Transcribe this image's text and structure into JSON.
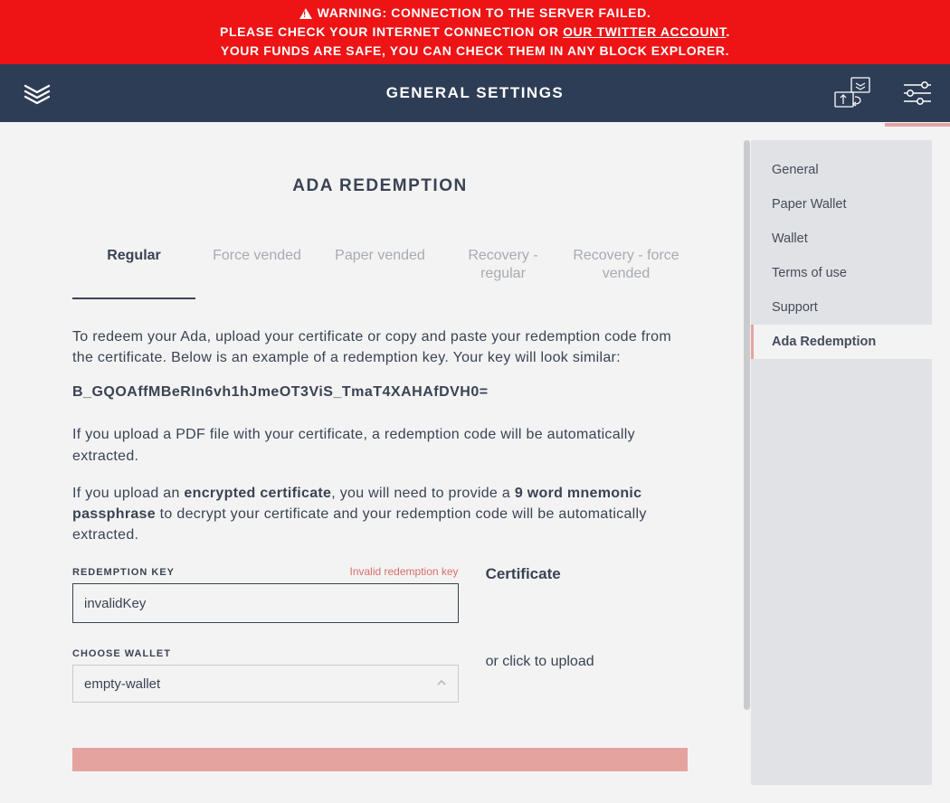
{
  "banner": {
    "line1": "WARNING: CONNECTION TO THE SERVER FAILED.",
    "line2_prefix": "PLEASE CHECK YOUR INTERNET CONNECTION OR ",
    "line2_link": "OUR TWITTER ACCOUNT",
    "line2_suffix": ".",
    "line3": "YOUR FUNDS ARE SAFE, YOU CAN CHECK THEM IN ANY BLOCK EXPLORER."
  },
  "header": {
    "title": "GENERAL SETTINGS"
  },
  "sidebar": {
    "items": [
      {
        "label": "General",
        "active": false
      },
      {
        "label": "Paper Wallet",
        "active": false
      },
      {
        "label": "Wallet",
        "active": false
      },
      {
        "label": "Terms of use",
        "active": false
      },
      {
        "label": "Support",
        "active": false
      },
      {
        "label": "Ada Redemption",
        "active": true
      }
    ]
  },
  "page": {
    "title": "ADA REDEMPTION"
  },
  "tabs": [
    {
      "label": "Regular",
      "active": true
    },
    {
      "label": "Force vended",
      "active": false
    },
    {
      "label": "Paper vended",
      "active": false
    },
    {
      "label": "Recovery - regular",
      "active": false
    },
    {
      "label": "Recovery - force vended",
      "active": false
    }
  ],
  "content": {
    "p1": "To redeem your Ada, upload your certificate or copy and paste your redemption code from the certificate. Below is an example of a redemption key. Your key will look similar:",
    "example_key": "B_GQOAffMBeRIn6vh1hJmeOT3ViS_TmaT4XAHAfDVH0=",
    "p2": "If you upload a PDF file with your certificate, a redemption code will be automatically extracted.",
    "p3_a": "If you upload an ",
    "p3_b": "encrypted certificate",
    "p3_c": ", you will need to provide a ",
    "p3_d": "9 word mnemonic passphrase",
    "p3_e": " to decrypt your certificate and your redemption code will be automatically extracted."
  },
  "form": {
    "redemption_key_label": "REDEMPTION KEY",
    "redemption_key_error": "Invalid redemption key",
    "redemption_key_value": "invalidKey",
    "choose_wallet_label": "CHOOSE WALLET",
    "choose_wallet_value": "empty-wallet",
    "certificate_title": "Certificate",
    "certificate_sub": "or click to upload"
  },
  "colors": {
    "warning_bg": "#ee1314",
    "header_bg": "#2e3d56",
    "accent": "#e5a3a0",
    "error": "#d86f6b"
  }
}
